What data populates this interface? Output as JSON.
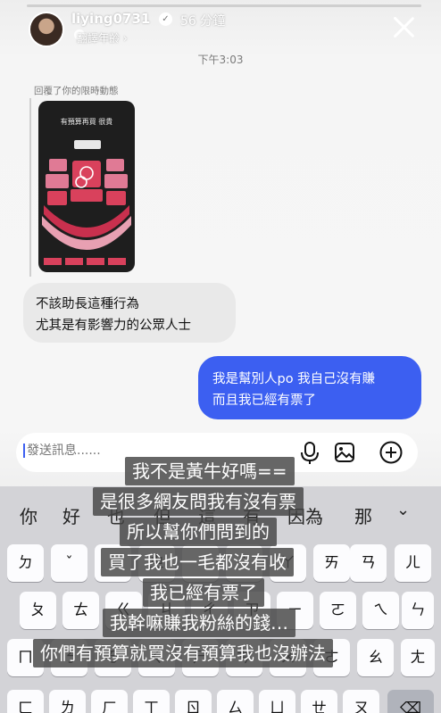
{
  "story": {
    "username": "liying0731",
    "time_ago": "56 分鐘",
    "translate_label": "翻譯年齡 ›"
  },
  "chat": {
    "timestamp": "下午3:03",
    "reply_label": "回覆了你的限時動態",
    "thumb_title": "有預算再買 很貴",
    "stage_label": "STAGE",
    "incoming": [
      "不該助長這種行為",
      "尤其是有影響力的公眾人士"
    ],
    "outgoing": [
      "我是幫別人po 我自己沒有賺",
      "而且我已經有票了"
    ]
  },
  "composer": {
    "placeholder": "發送訊息......"
  },
  "keyboard": {
    "candidates": [
      "你",
      "好",
      "也",
      "但",
      "這",
      "有",
      "因為",
      "那"
    ],
    "row1": [
      "ㄉ",
      "ˇ",
      "ˋ",
      "ㄓ",
      "ˊ",
      "˙",
      "ㄚ",
      "ㄞ",
      "ㄢ",
      "ㄦ"
    ],
    "row2": [
      "ㄆ",
      "ㄊ",
      "ㄍ",
      "ㄐ",
      "ㄔ",
      "ㄗ",
      "ㄧ",
      "ㄛ",
      "ㄟ",
      "ㄣ"
    ],
    "row3": [
      "ㄇ",
      "ㄋ",
      "ㄎ",
      "ㄑ",
      "ㄕ",
      "ㄘ",
      "ㄨ",
      "ㄜ",
      "ㄠ",
      "ㄤ"
    ],
    "row4": [
      "ㄈ",
      "ㄌ",
      "ㄏ",
      "ㄒ",
      "ㄖ",
      "ㄙ",
      "ㄩ",
      "ㄝ",
      "ㄡ",
      "ㄥ"
    ]
  },
  "captions": [
    "我不是黃牛好嗎==",
    "是很多網友問我有沒有票",
    "所以幫你們問到的",
    "買了我也一毛都沒有收",
    "我已經有票了",
    "我幹嘛賺我粉絲的錢…",
    "你們有預算就買沒有預算我也沒辦法"
  ],
  "colors": {
    "outgoing_bubble": "#3c5ff1",
    "incoming_bubble": "#e9e9e9",
    "seat_pink": "#d9415c"
  }
}
